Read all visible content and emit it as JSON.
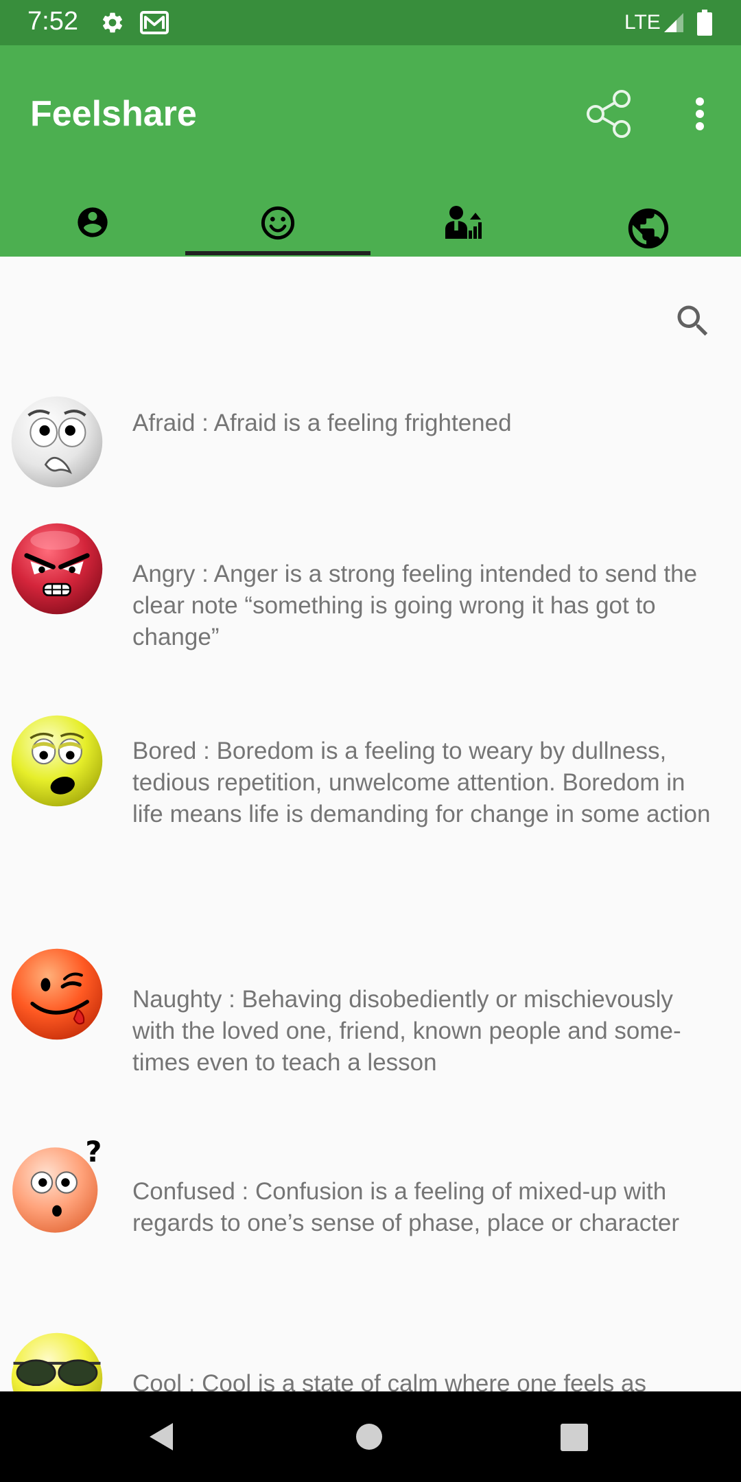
{
  "status_bar": {
    "time": "7:52",
    "network": "LTE",
    "icons": [
      "gear-icon",
      "gmail-icon",
      "signal-icon",
      "battery-icon"
    ]
  },
  "app_bar": {
    "title": "Feelshare",
    "actions": [
      "share-icon",
      "more-vert-icon"
    ],
    "background_color": "#4CAF50",
    "status_color": "#388E3C"
  },
  "tabs": {
    "items": [
      "account-circle-icon",
      "smiley-face-icon",
      "person-chart-icon",
      "globe-icon"
    ],
    "selected_index": 1
  },
  "search": {
    "icon": "search-icon"
  },
  "feelings": [
    {
      "emoji": "afraid-emoji-icon",
      "text": "Afraid : Afraid is a feeling frightened"
    },
    {
      "emoji": "angry-emoji-icon",
      "text": "Angry : Anger is a strong feeling intended to send the clear note “something is going wrong it has got to change”"
    },
    {
      "emoji": "bored-emoji-icon",
      "text": "Bored : Boredom is a feeling to weary by dullness, tedious repetition, unwelcome attention. Boredom in life means life is demanding for change in some action"
    },
    {
      "emoji": "naughty-emoji-icon",
      "text": "Naughty : Behaving disobediently or mischievously with the loved one, friend, known people and some-times even to teach a lesson"
    },
    {
      "emoji": "confused-emoji-icon",
      "text": "Confused : Confusion is a feeling of mixed-up with regards to one’s sense of phase, place or character"
    },
    {
      "emoji": "cool-emoji-icon",
      "text": "Cool : Cool is a state of calm where one feels as"
    }
  ],
  "nav_bar": {
    "buttons": [
      "back-icon",
      "home-icon",
      "recents-icon"
    ]
  }
}
